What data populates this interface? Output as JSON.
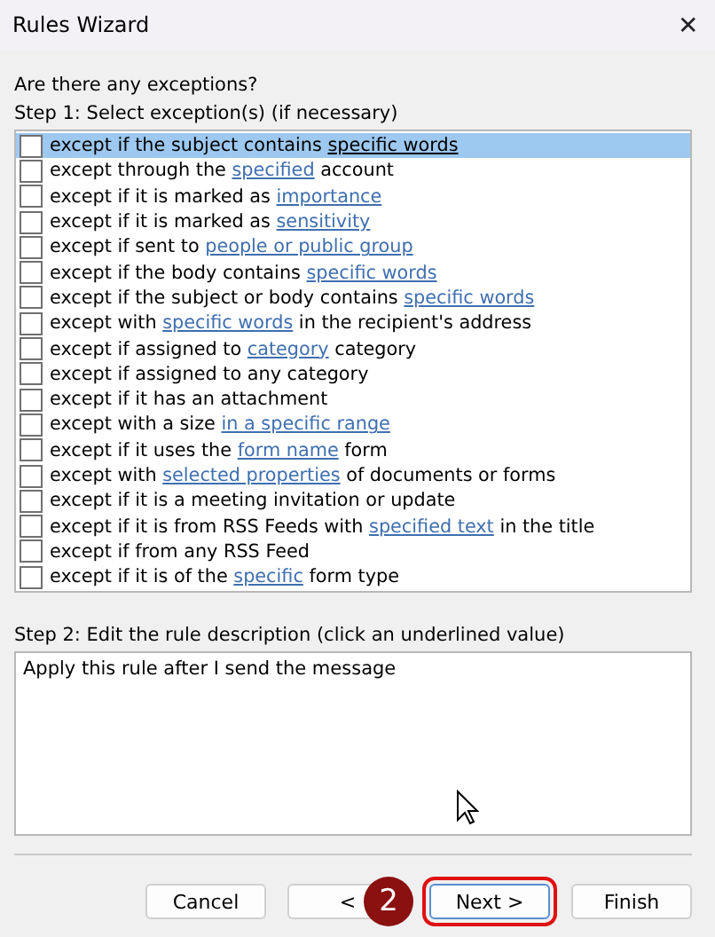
{
  "window": {
    "title": "Rules Wizard",
    "close": "✕"
  },
  "question": "Are there any exceptions?",
  "step1": {
    "label": "Step 1: Select exception(s) (if necessary)",
    "items": [
      {
        "checked": false,
        "selected": true,
        "parts": [
          {
            "text": "except if the subject contains ",
            "link": false
          },
          {
            "text": "specific words",
            "link": true
          }
        ]
      },
      {
        "checked": false,
        "selected": false,
        "parts": [
          {
            "text": "except through the ",
            "link": false
          },
          {
            "text": "specified",
            "link": true
          },
          {
            "text": " account",
            "link": false
          }
        ]
      },
      {
        "checked": false,
        "selected": false,
        "parts": [
          {
            "text": "except if it is marked as ",
            "link": false
          },
          {
            "text": "importance",
            "link": true
          }
        ]
      },
      {
        "checked": false,
        "selected": false,
        "parts": [
          {
            "text": "except if it is marked as ",
            "link": false
          },
          {
            "text": "sensitivity",
            "link": true
          }
        ]
      },
      {
        "checked": false,
        "selected": false,
        "parts": [
          {
            "text": "except if sent to ",
            "link": false
          },
          {
            "text": "people or public group",
            "link": true
          }
        ]
      },
      {
        "checked": false,
        "selected": false,
        "parts": [
          {
            "text": "except if the body contains ",
            "link": false
          },
          {
            "text": "specific words",
            "link": true
          }
        ]
      },
      {
        "checked": false,
        "selected": false,
        "parts": [
          {
            "text": "except if the subject or body contains ",
            "link": false
          },
          {
            "text": "specific words",
            "link": true
          }
        ]
      },
      {
        "checked": false,
        "selected": false,
        "parts": [
          {
            "text": "except with ",
            "link": false
          },
          {
            "text": "specific words",
            "link": true
          },
          {
            "text": " in the recipient's address",
            "link": false
          }
        ]
      },
      {
        "checked": false,
        "selected": false,
        "parts": [
          {
            "text": "except if assigned to ",
            "link": false
          },
          {
            "text": "category",
            "link": true
          },
          {
            "text": " category",
            "link": false
          }
        ]
      },
      {
        "checked": false,
        "selected": false,
        "parts": [
          {
            "text": "except if assigned to any category",
            "link": false
          }
        ]
      },
      {
        "checked": false,
        "selected": false,
        "parts": [
          {
            "text": "except if it has an attachment",
            "link": false
          }
        ]
      },
      {
        "checked": false,
        "selected": false,
        "parts": [
          {
            "text": "except with a size ",
            "link": false
          },
          {
            "text": "in a specific range",
            "link": true
          }
        ]
      },
      {
        "checked": false,
        "selected": false,
        "parts": [
          {
            "text": "except if it uses the ",
            "link": false
          },
          {
            "text": "form name",
            "link": true
          },
          {
            "text": " form",
            "link": false
          }
        ]
      },
      {
        "checked": false,
        "selected": false,
        "parts": [
          {
            "text": "except with ",
            "link": false
          },
          {
            "text": "selected properties",
            "link": true
          },
          {
            "text": " of documents or forms",
            "link": false
          }
        ]
      },
      {
        "checked": false,
        "selected": false,
        "parts": [
          {
            "text": "except if it is a meeting invitation or update",
            "link": false
          }
        ]
      },
      {
        "checked": false,
        "selected": false,
        "parts": [
          {
            "text": "except if it is from RSS Feeds with ",
            "link": false
          },
          {
            "text": "specified text",
            "link": true
          },
          {
            "text": " in the title",
            "link": false
          }
        ]
      },
      {
        "checked": false,
        "selected": false,
        "parts": [
          {
            "text": "except if from any RSS Feed",
            "link": false
          }
        ]
      },
      {
        "checked": false,
        "selected": false,
        "parts": [
          {
            "text": "except if it is of the ",
            "link": false
          },
          {
            "text": "specific",
            "link": true
          },
          {
            "text": " form type",
            "link": false
          }
        ]
      }
    ]
  },
  "step2": {
    "label": "Step 2: Edit the rule description (click an underlined value)",
    "description": "Apply this rule after I send the message"
  },
  "buttons": [
    {
      "label": "Cancel",
      "highlighted": false
    },
    {
      "label": "<",
      "highlighted": false
    },
    {
      "label": "Next >",
      "highlighted": true
    },
    {
      "label": "Finish",
      "highlighted": false
    }
  ],
  "step_badge": {
    "label": "2"
  }
}
